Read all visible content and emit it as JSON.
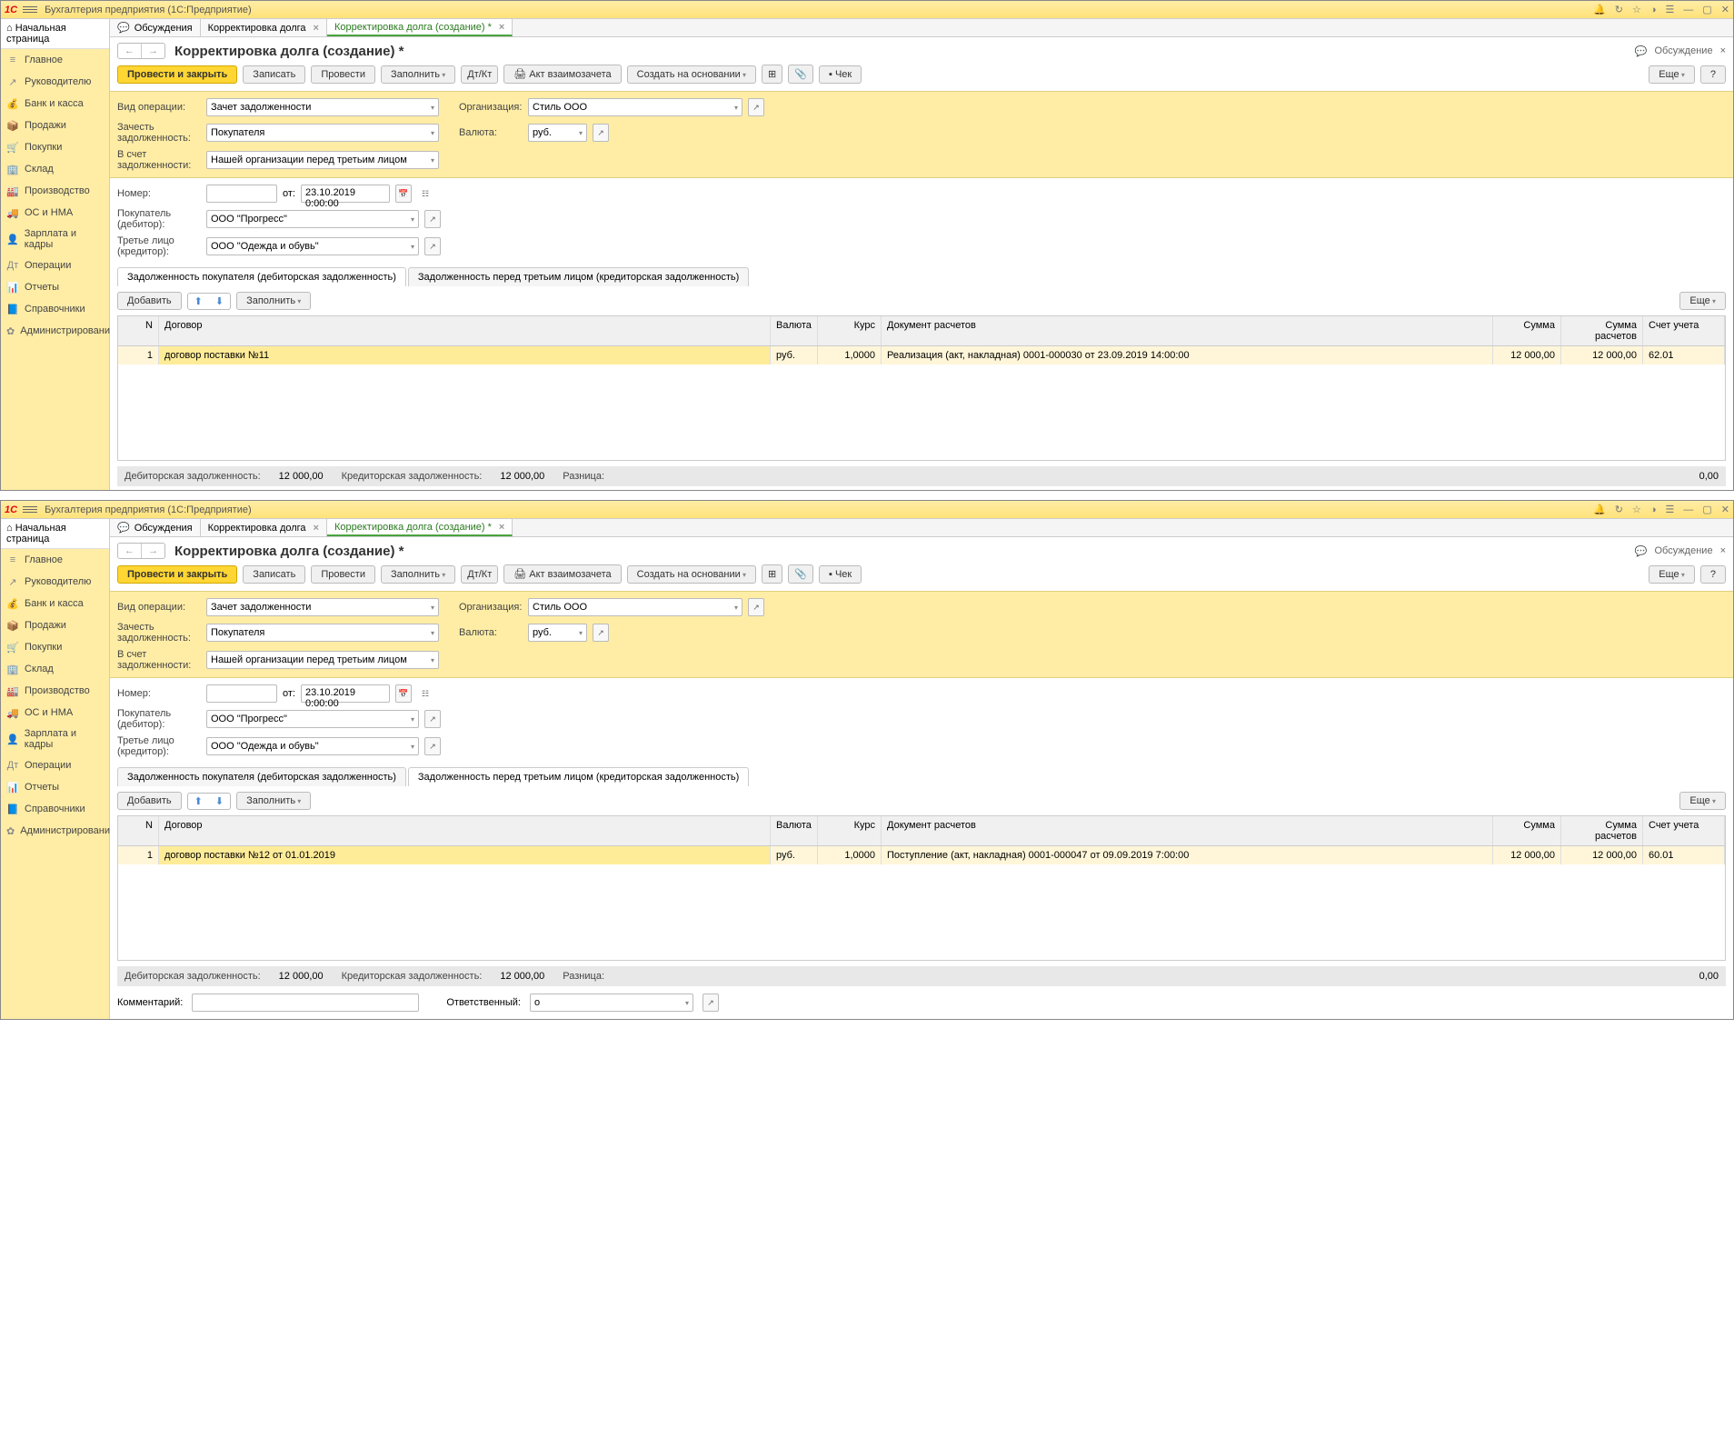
{
  "app": {
    "title": "Бухгалтерия предприятия  (1С:Предприятие)"
  },
  "sidebar": {
    "start": "Начальная страница",
    "items": [
      {
        "icon": "≡",
        "label": "Главное"
      },
      {
        "icon": "↗",
        "label": "Руководителю"
      },
      {
        "icon": "💰",
        "label": "Банк и касса"
      },
      {
        "icon": "📦",
        "label": "Продажи"
      },
      {
        "icon": "🛒",
        "label": "Покупки"
      },
      {
        "icon": "🏢",
        "label": "Склад"
      },
      {
        "icon": "🏭",
        "label": "Производство"
      },
      {
        "icon": "🚚",
        "label": "ОС и НМА"
      },
      {
        "icon": "👤",
        "label": "Зарплата и кадры"
      },
      {
        "icon": "Дт",
        "label": "Операции"
      },
      {
        "icon": "📊",
        "label": "Отчеты"
      },
      {
        "icon": "📘",
        "label": "Справочники"
      },
      {
        "icon": "✿",
        "label": "Администрирование"
      }
    ]
  },
  "tabs": [
    {
      "icon": "💬",
      "label": "Обсуждения",
      "close": false
    },
    {
      "label": "Корректировка долга",
      "close": true
    },
    {
      "label": "Корректировка долга (создание) *",
      "close": true,
      "active": true
    }
  ],
  "page_title": "Корректировка долга (создание) *",
  "discuss": {
    "label": "Обсуждение",
    "close": "×"
  },
  "toolbar": {
    "post_close": "Провести и закрыть",
    "write": "Записать",
    "post": "Провести",
    "fill": "Заполнить",
    "act": "Акт взаимозачета",
    "create_base": "Создать на основании",
    "check": "Чек",
    "more": "Еще",
    "help": "?"
  },
  "form": {
    "op_type_label": "Вид операции:",
    "op_type": "Зачет задолженности",
    "offset_label": "Зачесть задолженность:",
    "offset": "Покупателя",
    "against_label": "В счет задолженности:",
    "against": "Нашей организации перед третьим лицом",
    "org_label": "Организация:",
    "org": "Стиль ООО",
    "cur_label": "Валюта:",
    "cur": "руб.",
    "num_label": "Номер:",
    "ot": "от:",
    "date": "23.10.2019  0:00:00",
    "buyer_label": "Покупатель (дебитор):",
    "buyer": "ООО \"Прогресс\"",
    "third_label": "Третье лицо (кредитор):",
    "third": "ООО \"Одежда и обувь\""
  },
  "subtabs": {
    "t1": "Задолженность покупателя (дебиторская задолженность)",
    "t2": "Задолженность перед третьим лицом (кредиторская задолженность)"
  },
  "table_tools": {
    "add": "Добавить",
    "fill": "Заполнить",
    "more": "Еще"
  },
  "grid": {
    "head": {
      "n": "N",
      "dog": "Договор",
      "val": "Валюта",
      "kurs": "Курс",
      "doc": "Документ расчетов",
      "sum": "Сумма",
      "sumr": "Сумма расчетов",
      "acc": "Счет учета"
    }
  },
  "inst1": {
    "active_subtab": 1,
    "row": {
      "n": "1",
      "dog": "договор поставки №11",
      "val": "руб.",
      "kurs": "1,0000",
      "doc": "Реализация (акт, накладная) 0001-000030 от 23.09.2019 14:00:00",
      "sum": "12 000,00",
      "sumr": "12 000,00",
      "acc": "62.01"
    }
  },
  "inst2": {
    "active_subtab": 2,
    "row": {
      "n": "1",
      "dog": "договор поставки №12 от 01.01.2019",
      "val": "руб.",
      "kurs": "1,0000",
      "doc": "Поступление (акт, накладная) 0001-000047 от 09.09.2019 7:00:00",
      "sum": "12 000,00",
      "sumr": "12 000,00",
      "acc": "60.01"
    }
  },
  "status": {
    "deb_label": "Дебиторская задолженность:",
    "deb": "12 000,00",
    "cred_label": "Кредиторская задолженность:",
    "cred": "12 000,00",
    "diff_label": "Разница:",
    "diff": "0,00"
  },
  "footer": {
    "comment_label": "Комментарий:",
    "resp_label": "Ответственный:",
    "resp_val": "о"
  }
}
